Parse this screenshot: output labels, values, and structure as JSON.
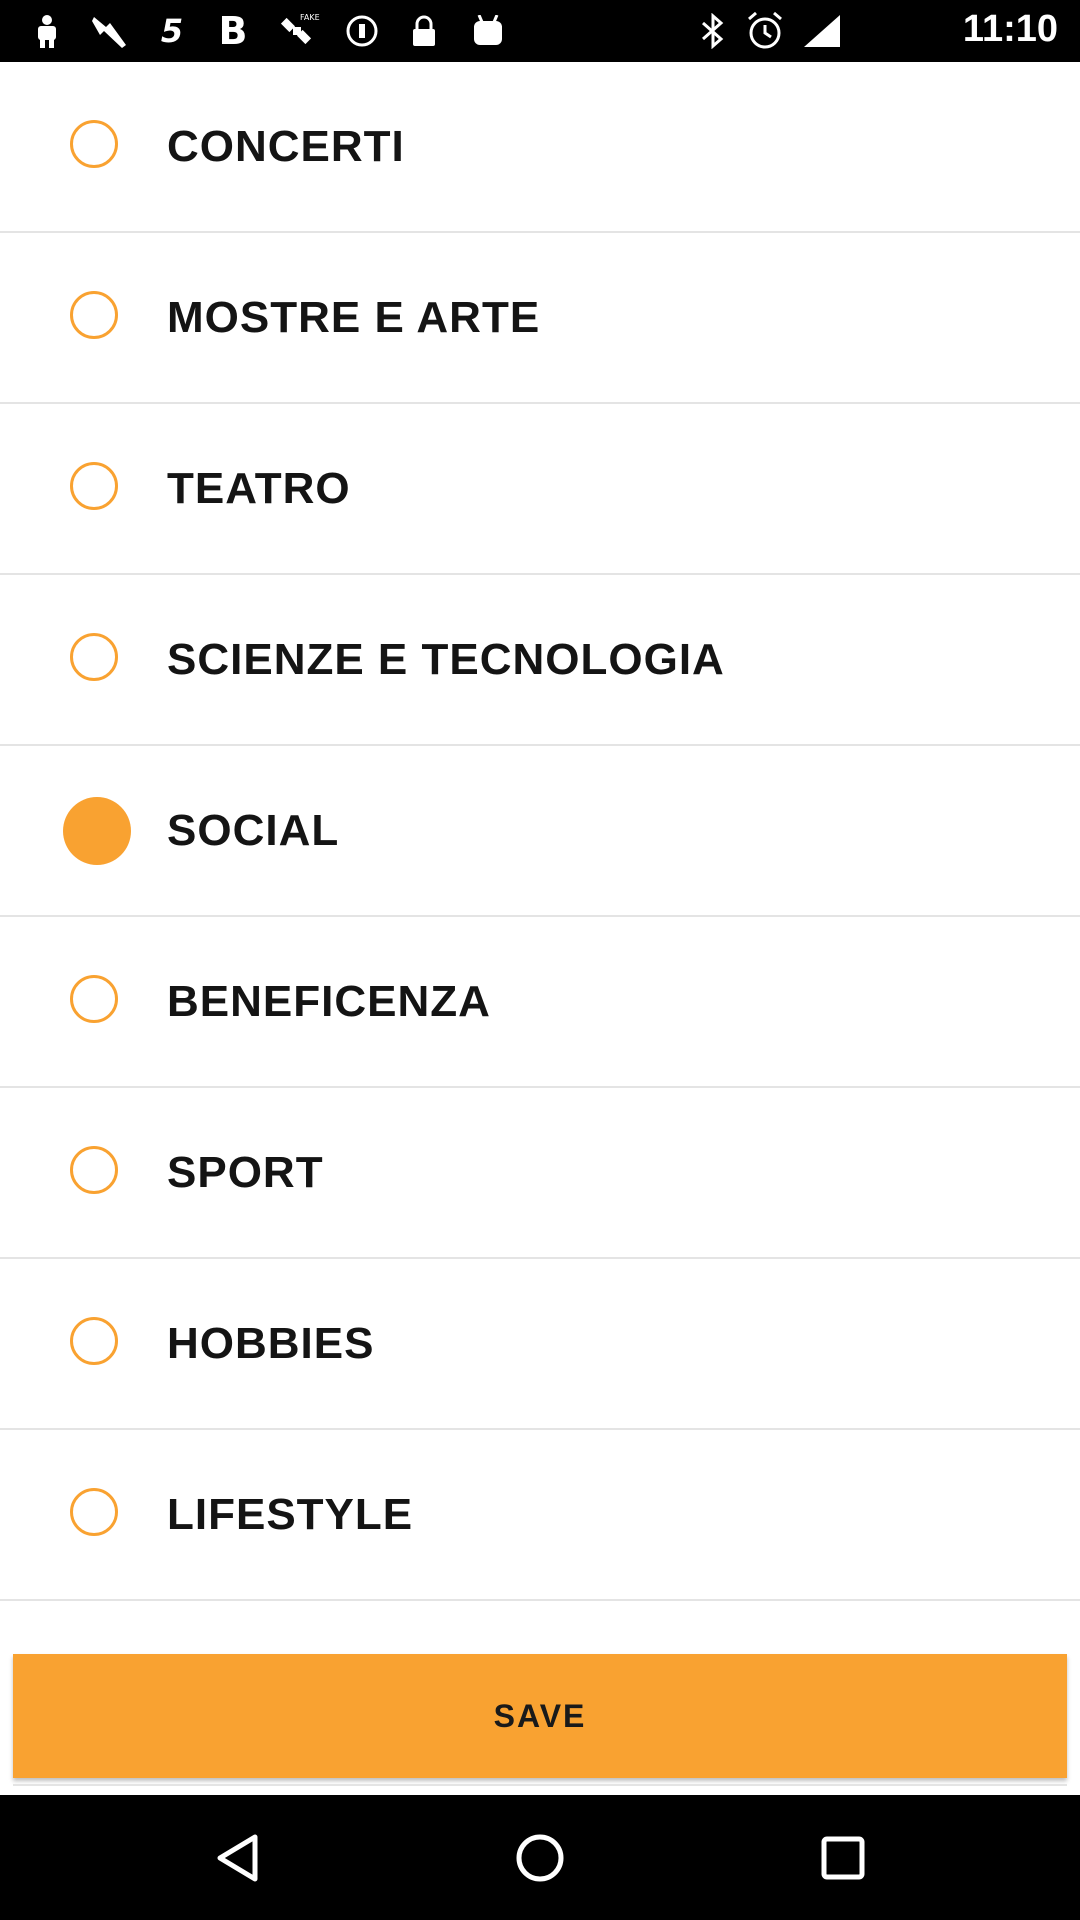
{
  "status_bar": {
    "time": "11:10",
    "left_icons": [
      "android-icon",
      "wrench-icon",
      "swiftkey-icon",
      "bold-b-icon",
      "fake-gps-satellite-icon",
      "info-icon",
      "lock-icon",
      "android-head-icon"
    ],
    "right_icons": [
      "bluetooth-icon",
      "alarm-icon",
      "signal-icon"
    ]
  },
  "categories": [
    {
      "label": "CONCERTI",
      "selected": false
    },
    {
      "label": "MOSTRE E ARTE",
      "selected": false
    },
    {
      "label": "TEATRO",
      "selected": false
    },
    {
      "label": "SCIENZE E TECNOLOGIA",
      "selected": false
    },
    {
      "label": "SOCIAL",
      "selected": true
    },
    {
      "label": "BENEFICENZA",
      "selected": false
    },
    {
      "label": "SPORT",
      "selected": false
    },
    {
      "label": "HOBBIES",
      "selected": false
    },
    {
      "label": "LIFESTYLE",
      "selected": false
    }
  ],
  "save_button": {
    "label": "SAVE"
  },
  "colors": {
    "accent": "#f9a231",
    "text": "#141414",
    "divider": "#e4e4e4"
  },
  "nav_bar": {
    "icons": [
      "back-icon",
      "home-icon",
      "recents-icon"
    ]
  }
}
